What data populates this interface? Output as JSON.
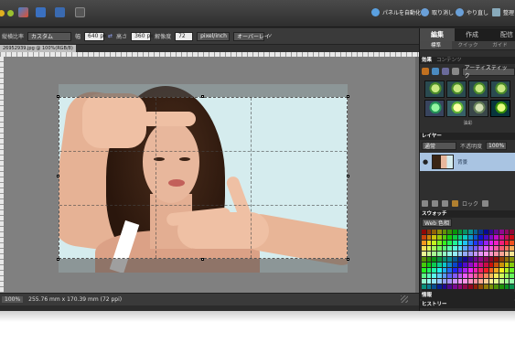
{
  "menubar": {
    "right_items": [
      {
        "icon": "organizer-icon",
        "label": "パネルを自動化"
      },
      {
        "icon": "undo-icon",
        "label": "取り消し"
      },
      {
        "icon": "redo-icon",
        "label": "やり直し"
      },
      {
        "icon": "organizer-grid-icon",
        "label": "整理"
      }
    ]
  },
  "options": {
    "aspect_label": "縦横比率",
    "aspect_value": "カスタム",
    "width_label": "幅",
    "width_value": "640 px",
    "height_label": "高さ",
    "height_value": "360 px",
    "resolution_label": "解像度",
    "resolution_value": "72",
    "resolution_unit": "pixel/inch",
    "overlay_value": "オーバーレイ"
  },
  "document": {
    "tab_title": "26952939.jpg @ 100%(RGB/8)"
  },
  "status": {
    "zoom": "100%",
    "info": "255.76 mm x 170.39 mm (72 ppi)"
  },
  "panel": {
    "tabs": [
      {
        "label": "編集",
        "active": true
      },
      {
        "label": "作成",
        "active": false
      },
      {
        "label": "配信",
        "active": false
      }
    ],
    "subtabs": [
      {
        "label": "標準",
        "active": true
      },
      {
        "label": "クイック",
        "active": false
      },
      {
        "label": "ガイド",
        "active": false
      }
    ],
    "effects_header": "効果",
    "content_header": "コンテンツ",
    "effects_select": "アーティスティック",
    "effects_caption": "油彩",
    "layers_header": "レイヤー",
    "blend_mode": "通常",
    "opacity_label": "不透明度",
    "opacity_value": "100%",
    "layer_name": "背景",
    "lock_label": "ロック",
    "swatches_header": "スウォッチ",
    "swatches_select": "Web 色相",
    "info_header": "情報",
    "history_header": "ヒストリー"
  }
}
